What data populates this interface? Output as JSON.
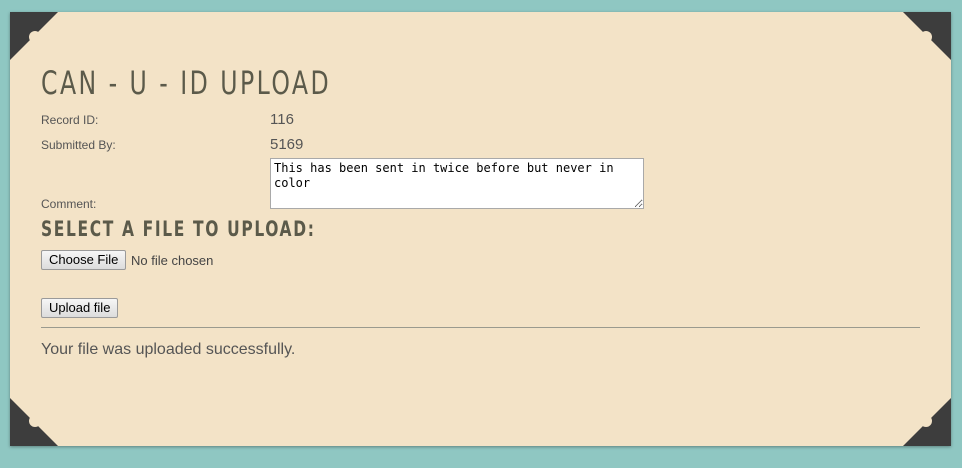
{
  "page": {
    "title": "CAN - U - ID UPLOAD"
  },
  "record": {
    "record_id_label": "Record ID:",
    "record_id_value": "116",
    "submitted_by_label": "Submitted By:",
    "submitted_by_value": "5169",
    "comment_label": "Comment:",
    "comment_value": "This has been sent in twice before but never in color"
  },
  "upload": {
    "heading": "SELECT A FILE TO UPLOAD:",
    "choose_file_label": "Choose File",
    "file_status": "No file chosen",
    "upload_button_label": "Upload file"
  },
  "status": {
    "message": "Your file was uploaded successfully."
  },
  "colors": {
    "background": "#8fc7c2",
    "card": "#f3e3c7",
    "corner": "#3d3d3d",
    "title_text": "#5b5a4a"
  }
}
